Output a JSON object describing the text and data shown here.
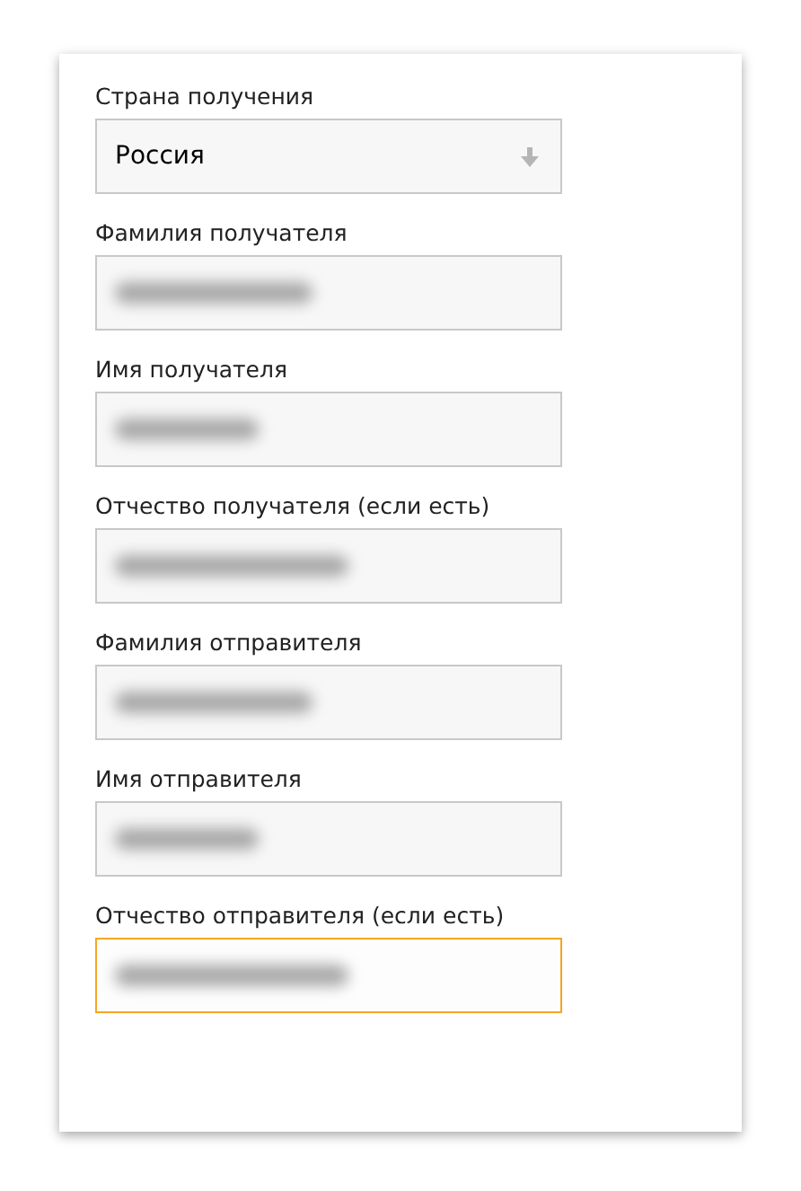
{
  "fields": [
    {
      "kind": "select",
      "label": "Страна получения",
      "value": "Россия",
      "focused": false
    },
    {
      "kind": "text",
      "label": "Фамилия получателя",
      "blurred": true,
      "focused": false
    },
    {
      "kind": "text",
      "label": "Имя получателя",
      "blurred": true,
      "focused": false
    },
    {
      "kind": "text",
      "label": "Отчество получателя (если есть)",
      "blurred": true,
      "focused": false
    },
    {
      "kind": "text",
      "label": "Фамилия отправителя",
      "blurred": true,
      "focused": false
    },
    {
      "kind": "text",
      "label": "Имя отправителя",
      "blurred": true,
      "focused": false
    },
    {
      "kind": "text",
      "label": "Отчество отправителя (если есть)",
      "blurred": true,
      "focused": true
    }
  ]
}
